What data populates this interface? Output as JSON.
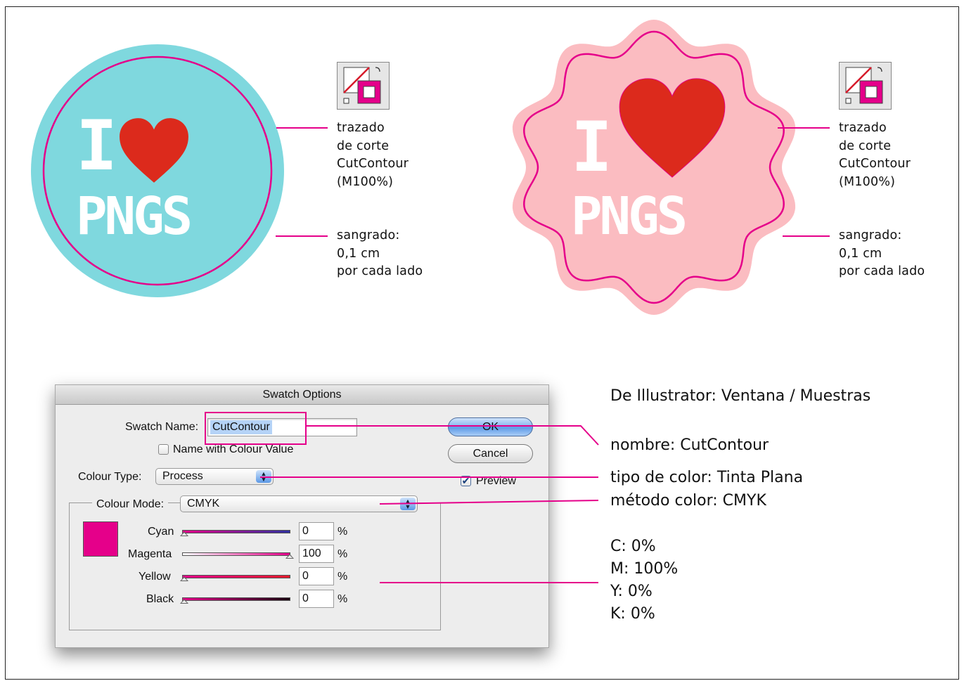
{
  "colors": {
    "cut_contour": "#e5008a",
    "circle_fill": "#7fd8de",
    "star_fill": "#fbbcc1",
    "heart_red": "#dc2a1c",
    "logo_text": "#ffffff"
  },
  "logos": {
    "left": {
      "letter": "I",
      "word": "PNGS",
      "heart_icon": "heart-icon"
    },
    "right": {
      "letter": "I",
      "word": "PNGS",
      "heart_icon": "heart-icon"
    }
  },
  "annotations_left": {
    "fill_stroke_icon": "fill-stroke-swatch-icon",
    "stroke_lines": [
      "trazado",
      "de corte",
      "CutContour",
      "(M100%)"
    ],
    "bleed_lines": [
      "sangrado:",
      "0,1 cm",
      "por cada lado"
    ]
  },
  "annotations_right": {
    "fill_stroke_icon": "fill-stroke-swatch-icon",
    "stroke_lines": [
      "trazado",
      "de corte",
      "CutContour",
      "(M100%)"
    ],
    "bleed_lines": [
      "sangrado:",
      "0,1 cm",
      "por cada lado"
    ]
  },
  "dialog": {
    "title": "Swatch Options",
    "swatch_name_label": "Swatch Name:",
    "swatch_name_value": "CutContour",
    "name_with_value_label": "Name with Colour Value",
    "name_with_value_checked": false,
    "colour_type_label": "Colour Type:",
    "colour_type_value": "Process",
    "colour_mode_label": "Colour Mode:",
    "colour_mode_value": "CMYK",
    "ok_label": "OK",
    "cancel_label": "Cancel",
    "preview_label": "Preview",
    "preview_checked": true,
    "swatch_color": "#e5008a",
    "channels": [
      {
        "label": "Cyan",
        "value": "0",
        "unit": "%"
      },
      {
        "label": "Magenta",
        "value": "100",
        "unit": "%"
      },
      {
        "label": "Yellow",
        "value": "0",
        "unit": "%"
      },
      {
        "label": "Black",
        "value": "0",
        "unit": "%"
      }
    ]
  },
  "notes": {
    "heading": "De Illustrator: Ventana / Muestras",
    "name": "nombre: CutContour",
    "type": "tipo de color: Tinta Plana",
    "mode": "método color: CMYK",
    "values": [
      "C: 0%",
      "M: 100%",
      "Y: 0%",
      "K: 0%"
    ]
  }
}
